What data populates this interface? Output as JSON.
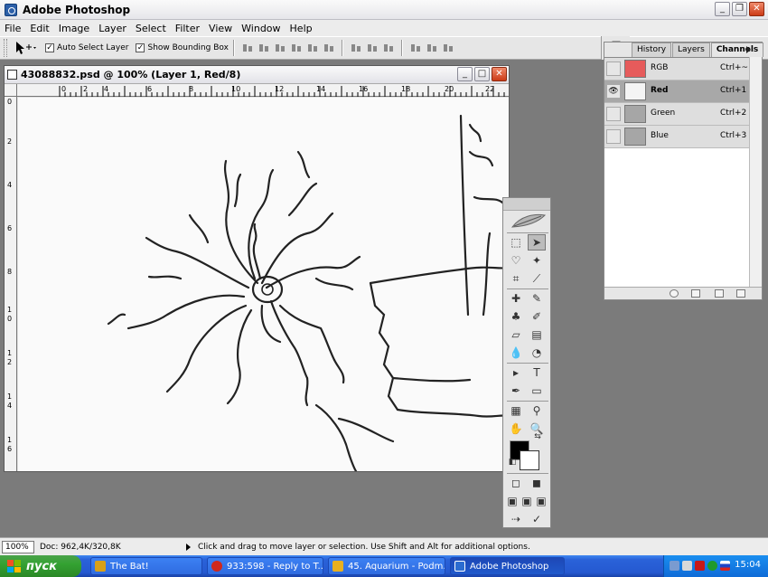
{
  "app": {
    "title": "Adobe Photoshop"
  },
  "menu": [
    "File",
    "Edit",
    "Image",
    "Layer",
    "Select",
    "Filter",
    "View",
    "Window",
    "Help"
  ],
  "options": {
    "auto_select_layer": "Auto Select Layer",
    "show_bounding_box": "Show Bounding Box"
  },
  "document": {
    "title": "43088832.psd @ 100% (Layer 1, Red/8)",
    "ruler_h": [
      "0",
      "2",
      "4",
      "6",
      "8",
      "10",
      "12",
      "14",
      "16",
      "18",
      "20",
      "22"
    ],
    "ruler_v": [
      "0",
      "2",
      "4",
      "6",
      "8",
      "1",
      "0",
      "1",
      "2",
      "1",
      "4",
      "1",
      "6"
    ]
  },
  "panel": {
    "tabs": [
      "History",
      "Layers",
      "Channels"
    ],
    "channels": [
      {
        "name": "RGB",
        "shortcut": "Ctrl+~",
        "thumb_color": "#e65b5b",
        "visible": false
      },
      {
        "name": "Red",
        "shortcut": "Ctrl+1",
        "thumb_color": "#f4f4f4",
        "visible": true
      },
      {
        "name": "Green",
        "shortcut": "Ctrl+2",
        "thumb_color": "#a6a6a6",
        "visible": false
      },
      {
        "name": "Blue",
        "shortcut": "Ctrl+3",
        "thumb_color": "#a6a6a6",
        "visible": false
      }
    ]
  },
  "status": {
    "zoom": "100%",
    "doc_info": "Doc: 962,4K/320,8K",
    "message": "Click and drag to move layer or selection.  Use Shift and Alt for additional options."
  },
  "taskbar": {
    "start": "пуск",
    "tasks": [
      {
        "label": "The Bat!",
        "color": "#d8a018"
      },
      {
        "label": "933:598 - Reply to T...",
        "color": "#d0281c"
      },
      {
        "label": "45. Aquarium - Podm...",
        "color": "#e8b020"
      },
      {
        "label": "Adobe Photoshop",
        "color": "#2c6cd0"
      }
    ],
    "clock": "15:04"
  }
}
